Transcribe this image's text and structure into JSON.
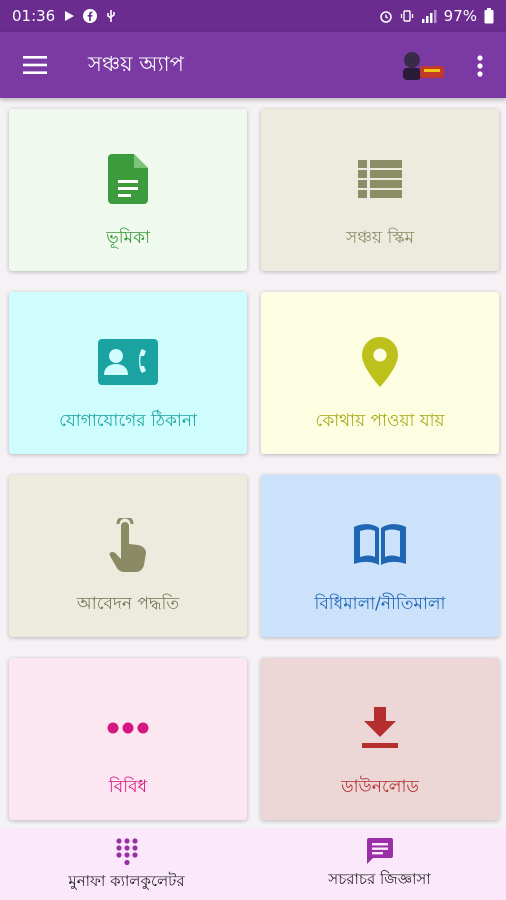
{
  "status": {
    "time": "01:36",
    "battery": "97%"
  },
  "app_bar": {
    "title": "সঞ্চয় অ্যাপ"
  },
  "cards": [
    {
      "label": "ভূমিকা",
      "icon": "document-icon",
      "color": "#3c9b3c",
      "bg": "#eff9ee"
    },
    {
      "label": "সঞ্চয় স্কিম",
      "icon": "list-icon",
      "color": "#8a8f68",
      "bg": "#ecebde"
    },
    {
      "label": "যোগাযোগের ঠিকানা",
      "icon": "contact-phone-icon",
      "color": "#1aa3a0",
      "bg": "#cffcfd"
    },
    {
      "label": "কোথায় পাওয়া যায়",
      "icon": "location-pin-icon",
      "color": "#bcc11b",
      "bg": "#fdfde2"
    },
    {
      "label": "আবেদন পদ্ধতি",
      "icon": "touch-hand-icon",
      "color": "#8a8a64",
      "bg": "#ecebde"
    },
    {
      "label": "বিধিমালা/নীতিমালা",
      "icon": "book-icon",
      "color": "#1f66b4",
      "bg": "#cce2fb"
    },
    {
      "label": "বিবিধ",
      "icon": "more-dots-icon",
      "color": "#d6177e",
      "bg": "#fce6f1"
    },
    {
      "label": "ডাউনলোড",
      "icon": "download-icon",
      "color": "#b52e2e",
      "bg": "#ecd6d6"
    }
  ],
  "bottom_nav": [
    {
      "label": "মুনাফা ক্যালকুলেটর",
      "icon": "dialpad-icon"
    },
    {
      "label": "সচরাচর জিজ্ঞাসা",
      "icon": "message-icon"
    }
  ],
  "colors": {
    "status_bar": "#6a2c8e",
    "app_bar": "#7b3aa3",
    "accent": "#9b2fa8",
    "bottom_nav_bg": "#fce8fb"
  }
}
